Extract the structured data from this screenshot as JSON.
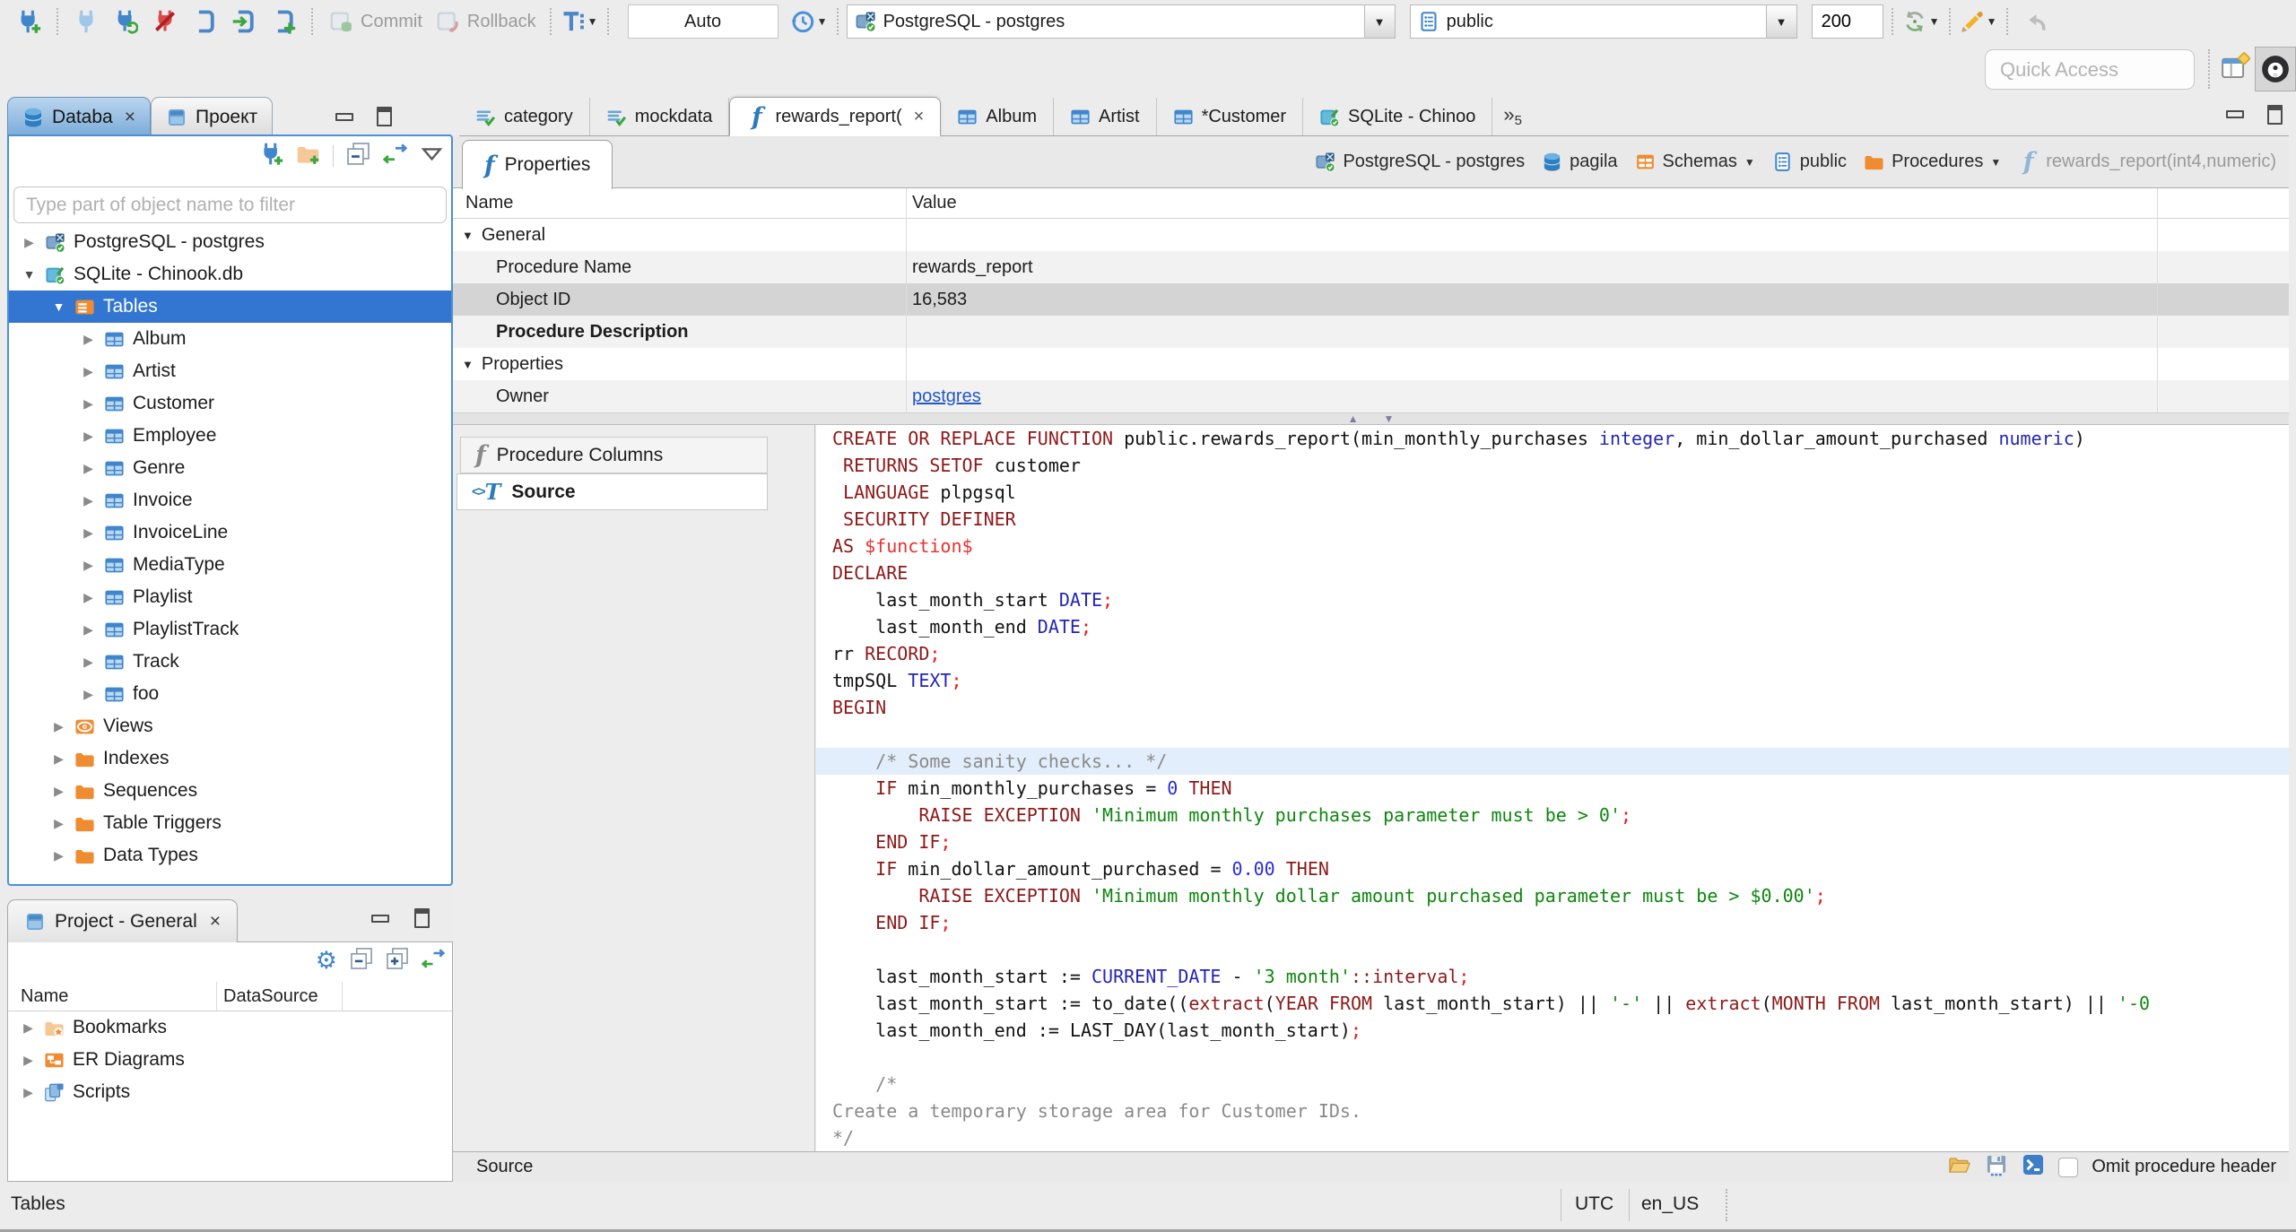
{
  "toolbar": {
    "commit": "Commit",
    "rollback": "Rollback",
    "auto": "Auto",
    "connection": "PostgreSQL - postgres",
    "schema": "public",
    "fetch_size": "200",
    "quick_access_placeholder": "Quick Access"
  },
  "window_tabs": [
    {
      "label": "Databa",
      "icon": "db",
      "active": true,
      "closable": true
    },
    {
      "label": "Проект",
      "icon": "project"
    }
  ],
  "navigator": {
    "filter_placeholder": "Type part of object name to filter",
    "tree": [
      {
        "label": "PostgreSQL - postgres",
        "icon": "postgres",
        "level": 0,
        "exp": "c"
      },
      {
        "label": "SQLite - Chinook.db",
        "icon": "sqlite",
        "level": 0,
        "exp": "e"
      },
      {
        "label": "Tables",
        "icon": "tables",
        "level": 1,
        "exp": "e",
        "selected": true
      },
      {
        "label": "Album",
        "icon": "table",
        "level": 2,
        "exp": "c"
      },
      {
        "label": "Artist",
        "icon": "table",
        "level": 2,
        "exp": "c"
      },
      {
        "label": "Customer",
        "icon": "table",
        "level": 2,
        "exp": "c"
      },
      {
        "label": "Employee",
        "icon": "table",
        "level": 2,
        "exp": "c"
      },
      {
        "label": "Genre",
        "icon": "table",
        "level": 2,
        "exp": "c"
      },
      {
        "label": "Invoice",
        "icon": "table",
        "level": 2,
        "exp": "c"
      },
      {
        "label": "InvoiceLine",
        "icon": "table",
        "level": 2,
        "exp": "c"
      },
      {
        "label": "MediaType",
        "icon": "table",
        "level": 2,
        "exp": "c"
      },
      {
        "label": "Playlist",
        "icon": "table",
        "level": 2,
        "exp": "c"
      },
      {
        "label": "PlaylistTrack",
        "icon": "table",
        "level": 2,
        "exp": "c"
      },
      {
        "label": "Track",
        "icon": "table",
        "level": 2,
        "exp": "c"
      },
      {
        "label": "foo",
        "icon": "table",
        "level": 2,
        "exp": "c"
      },
      {
        "label": "Views",
        "icon": "eye",
        "level": 1,
        "exp": "c"
      },
      {
        "label": "Indexes",
        "icon": "folder",
        "level": 1,
        "exp": "c"
      },
      {
        "label": "Sequences",
        "icon": "folder",
        "level": 1,
        "exp": "c"
      },
      {
        "label": "Table Triggers",
        "icon": "folder",
        "level": 1,
        "exp": "c"
      },
      {
        "label": "Data Types",
        "icon": "folder",
        "level": 1,
        "exp": "c"
      }
    ]
  },
  "project": {
    "title": "Project - General",
    "columns": [
      "Name",
      "DataSource"
    ],
    "items": [
      {
        "label": "Bookmarks",
        "icon": "bookmarks"
      },
      {
        "label": "ER Diagrams",
        "icon": "erd"
      },
      {
        "label": "Scripts",
        "icon": "scripts"
      }
    ]
  },
  "editor_tabs": [
    {
      "label": "category",
      "icon": "sqlfile"
    },
    {
      "label": "mockdata",
      "icon": "sqlfile"
    },
    {
      "label": "rewards_report(",
      "icon": "fn-blue",
      "active": true,
      "closable": true
    },
    {
      "label": "Album",
      "icon": "table"
    },
    {
      "label": "Artist",
      "icon": "table"
    },
    {
      "label": "*Customer",
      "icon": "table"
    },
    {
      "label": "SQLite - Chinoo",
      "icon": "sqlite"
    }
  ],
  "editor_overflow": "5",
  "properties_view": {
    "tab_label": "Properties",
    "breadcrumb": [
      {
        "label": "PostgreSQL - postgres",
        "icon": "postgres"
      },
      {
        "label": "pagila",
        "icon": "db"
      },
      {
        "label": "Schemas",
        "icon": "schemas",
        "dropdown": true
      },
      {
        "label": "public",
        "icon": "page"
      },
      {
        "label": "Procedures",
        "icon": "folder",
        "dropdown": true
      },
      {
        "label": "rewards_report(int4,numeric)",
        "icon": "fn-light",
        "muted": true
      }
    ],
    "columns": [
      "Name",
      "Value"
    ],
    "rows": [
      {
        "type": "group",
        "name": "General"
      },
      {
        "type": "item",
        "name": "Procedure Name",
        "value": "rewards_report"
      },
      {
        "type": "item",
        "name": "Object ID",
        "value": "16,583",
        "selected": true
      },
      {
        "type": "item",
        "name": "Procedure Description",
        "bold": true
      },
      {
        "type": "group",
        "name": "Properties"
      },
      {
        "type": "item",
        "name": "Owner",
        "value": "postgres",
        "link": true
      }
    ]
  },
  "source_view": {
    "side_tabs": [
      {
        "label": "Procedure Columns",
        "icon": "fn-gray"
      },
      {
        "label": "Source",
        "icon": "srct",
        "active": true
      }
    ],
    "footer_label": "Source",
    "omit_label": "Omit procedure header",
    "highlight_line": 12,
    "code": [
      [
        [
          "k",
          "CREATE OR REPLACE FUNCTION "
        ],
        [
          "p",
          "public.rewards_report(min_monthly_purchases "
        ],
        [
          "t",
          "integer"
        ],
        [
          "p",
          ", min_dollar_amount_purchased "
        ],
        [
          "t",
          "numeric"
        ],
        [
          "p",
          ")"
        ]
      ],
      [
        [
          "p",
          " "
        ],
        [
          "k",
          "RETURNS SETOF "
        ],
        [
          "p",
          "customer"
        ]
      ],
      [
        [
          "p",
          " "
        ],
        [
          "k",
          "LANGUAGE "
        ],
        [
          "p",
          "plpgsql"
        ]
      ],
      [
        [
          "p",
          " "
        ],
        [
          "k",
          "SECURITY DEFINER"
        ]
      ],
      [
        [
          "k",
          "AS "
        ],
        [
          "d",
          "$function$"
        ]
      ],
      [
        [
          "k",
          "DECLARE"
        ]
      ],
      [
        [
          "p",
          "    last_month_start "
        ],
        [
          "t",
          "DATE"
        ],
        [
          "r",
          ";"
        ]
      ],
      [
        [
          "p",
          "    last_month_end "
        ],
        [
          "t",
          "DATE"
        ],
        [
          "r",
          ";"
        ]
      ],
      [
        [
          "p",
          "rr "
        ],
        [
          "k",
          "RECORD"
        ],
        [
          "r",
          ";"
        ]
      ],
      [
        [
          "p",
          "tmpSQL "
        ],
        [
          "t",
          "TEXT"
        ],
        [
          "r",
          ";"
        ]
      ],
      [
        [
          "k",
          "BEGIN"
        ]
      ],
      [],
      [
        [
          "c",
          "    /* Some sanity checks... */"
        ]
      ],
      [
        [
          "p",
          "    "
        ],
        [
          "k",
          "IF"
        ],
        [
          "p",
          " min_monthly_purchases = "
        ],
        [
          "n",
          "0"
        ],
        [
          "p",
          " "
        ],
        [
          "k",
          "THEN"
        ]
      ],
      [
        [
          "p",
          "        "
        ],
        [
          "k",
          "RAISE EXCEPTION "
        ],
        [
          "s",
          "'Minimum monthly purchases parameter must be > 0'"
        ],
        [
          "r",
          ";"
        ]
      ],
      [
        [
          "p",
          "    "
        ],
        [
          "k",
          "END IF"
        ],
        [
          "r",
          ";"
        ]
      ],
      [
        [
          "p",
          "    "
        ],
        [
          "k",
          "IF"
        ],
        [
          "p",
          " min_dollar_amount_purchased = "
        ],
        [
          "n",
          "0.00"
        ],
        [
          "p",
          " "
        ],
        [
          "k",
          "THEN"
        ]
      ],
      [
        [
          "p",
          "        "
        ],
        [
          "k",
          "RAISE EXCEPTION "
        ],
        [
          "s",
          "'Minimum monthly dollar amount purchased parameter must be > $0.00'"
        ],
        [
          "r",
          ";"
        ]
      ],
      [
        [
          "p",
          "    "
        ],
        [
          "k",
          "END IF"
        ],
        [
          "r",
          ";"
        ]
      ],
      [],
      [
        [
          "p",
          "    last_month_start := "
        ],
        [
          "t",
          "CURRENT_DATE"
        ],
        [
          "p",
          " - "
        ],
        [
          "s",
          "'3 month'"
        ],
        [
          "k",
          "::interval"
        ],
        [
          "r",
          ";"
        ]
      ],
      [
        [
          "p",
          "    last_month_start := to_date(("
        ],
        [
          "k",
          "extract"
        ],
        [
          "p",
          "("
        ],
        [
          "k",
          "YEAR FROM"
        ],
        [
          "p",
          " last_month_start) || "
        ],
        [
          "s",
          "'-'"
        ],
        [
          "p",
          " || "
        ],
        [
          "k",
          "extract"
        ],
        [
          "p",
          "("
        ],
        [
          "k",
          "MONTH FROM"
        ],
        [
          "p",
          " last_month_start) || "
        ],
        [
          "s",
          "'-0"
        ]
      ],
      [
        [
          "p",
          "    last_month_end := LAST_DAY(last_month_start)"
        ],
        [
          "r",
          ";"
        ]
      ],
      [],
      [
        [
          "p",
          "    "
        ],
        [
          "c",
          "/*"
        ]
      ],
      [
        [
          "c",
          "Create a temporary storage area for Customer IDs."
        ]
      ],
      [
        [
          "c",
          "*/"
        ]
      ]
    ]
  },
  "status_bar": {
    "selection": "Tables",
    "timezone": "UTC",
    "locale": "en_US"
  },
  "colors": {
    "accent_blue": "#4a90d9",
    "selection_blue": "#3276d2",
    "keyword": "#8e1919",
    "string": "#0c870c",
    "type": "#2525b4",
    "comment": "#8a8a8a",
    "highlight_line": "#e2eefb",
    "folder_orange": "#ef8b31"
  }
}
